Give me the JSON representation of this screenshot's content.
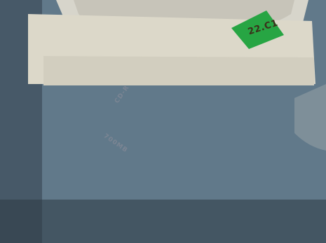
{
  "photo": {
    "description_visible_text": {
      "sticker_text": "22.C1",
      "disc_text_top": "CD-R",
      "disc_text_side": "700MB"
    },
    "annotation": {
      "color": "#e8101e"
    },
    "colors": {
      "background": "#5f7683",
      "computer_case": "#d9d4c4",
      "disc": "#c8d0dc",
      "tray": "#e8e6df",
      "keyboard": "#e4e0d4"
    }
  }
}
